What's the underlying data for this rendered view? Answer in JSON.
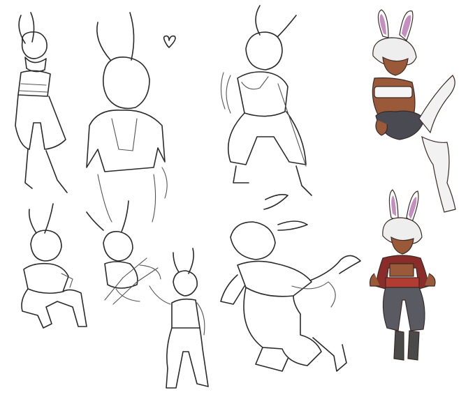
{
  "canvas": {
    "background": "#ffffff",
    "line_color": "#2a2a2a"
  },
  "palette": {
    "ear_inner": "#c58dc0",
    "skin_dark": "#9a5a3a",
    "hair": "#eeeeee",
    "tube_top": "#f5f5f5",
    "shorts": "#4a4a52",
    "stockings": "#f2f2f2",
    "jacket": "#8a2c2a",
    "belt": "#b33b32",
    "pants": "#5a5a62",
    "boots": "#4a4a4a"
  },
  "sketches": [
    {
      "id": "sketch-standing-scarf",
      "rendering": "line-art"
    },
    {
      "id": "sketch-jacket-heart",
      "rendering": "line-art",
      "decoration": "heart-icon"
    },
    {
      "id": "sketch-holding-blade",
      "rendering": "line-art"
    },
    {
      "id": "sketch-sitting-colored",
      "rendering": "color"
    },
    {
      "id": "sketch-crouching",
      "rendering": "line-art"
    },
    {
      "id": "sketch-crouch-slash",
      "rendering": "line-art"
    },
    {
      "id": "sketch-standing-small",
      "rendering": "line-art"
    },
    {
      "id": "sketch-running-sickle",
      "rendering": "line-art"
    },
    {
      "id": "sketch-standing-colored",
      "rendering": "color"
    }
  ]
}
